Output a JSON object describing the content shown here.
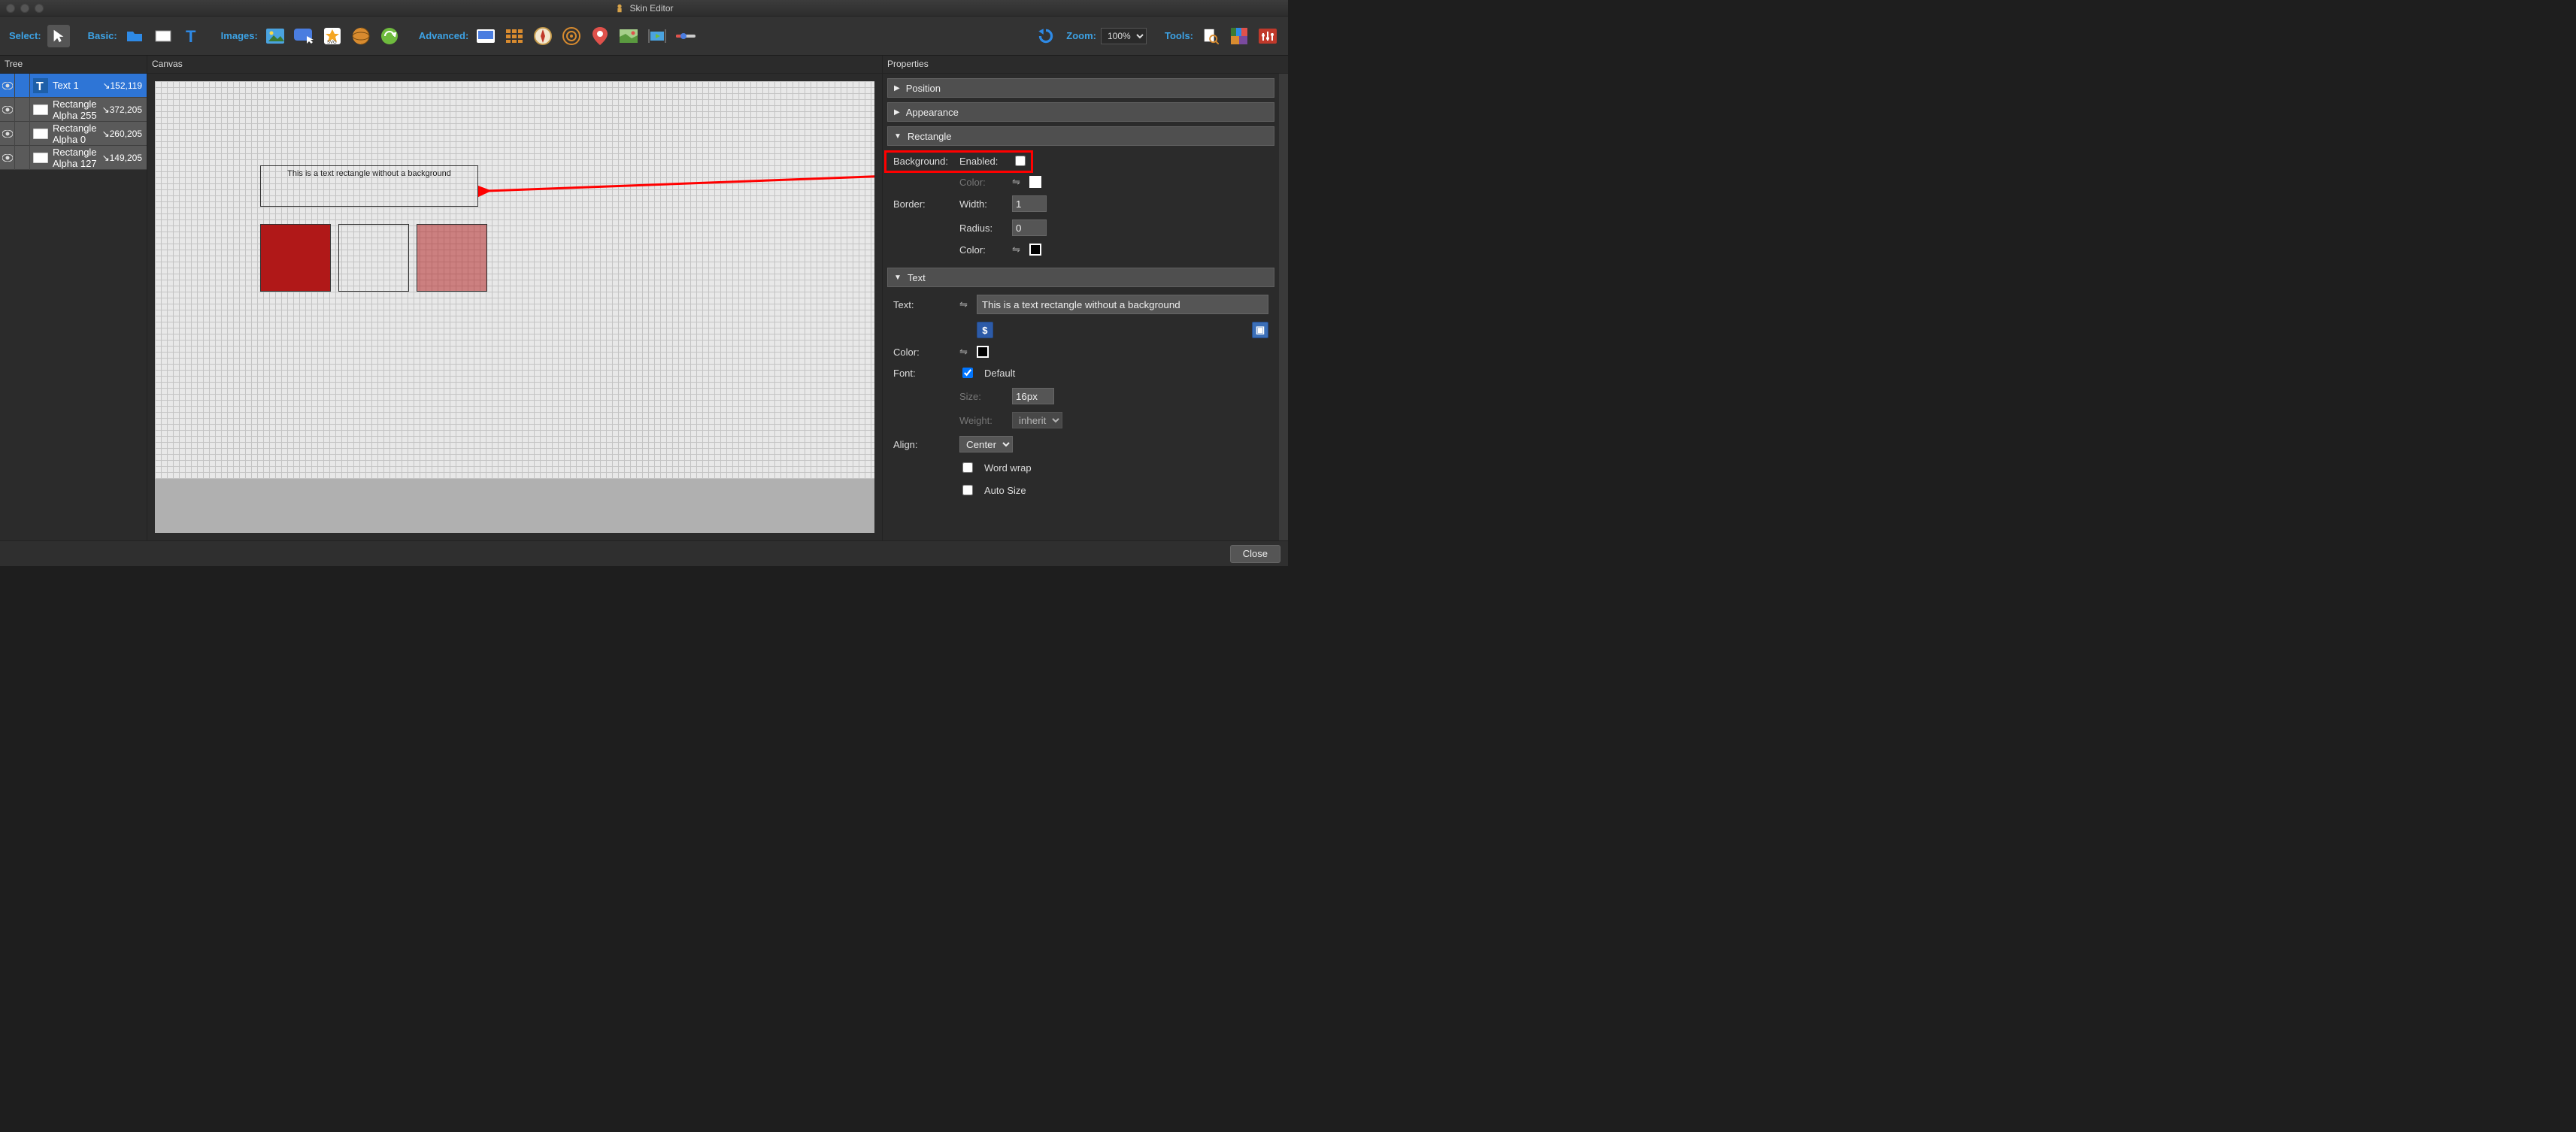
{
  "window": {
    "title": "Skin Editor"
  },
  "toolbar": {
    "select_label": "Select:",
    "basic_label": "Basic:",
    "images_label": "Images:",
    "advanced_label": "Advanced:",
    "zoom_label": "Zoom:",
    "zoom_value": "100%",
    "tools_label": "Tools:"
  },
  "panels": {
    "tree": "Tree",
    "canvas": "Canvas",
    "properties": "Properties"
  },
  "tree": {
    "items": [
      {
        "name": "Text 1",
        "coord": "↘152,119",
        "selected": true,
        "icon": "text"
      },
      {
        "name": "Rectangle Alpha 255",
        "coord": "↘372,205",
        "selected": false,
        "icon": "rect"
      },
      {
        "name": "Rectangle Alpha 0",
        "coord": "↘260,205",
        "selected": false,
        "icon": "rect"
      },
      {
        "name": "Rectangle Alpha 127",
        "coord": "↘149,205",
        "selected": false,
        "icon": "rect"
      }
    ]
  },
  "canvas": {
    "text_content": "This is a text rectangle without a background"
  },
  "props": {
    "sections": {
      "position": "Position",
      "appearance": "Appearance",
      "rectangle": "Rectangle",
      "text": "Text"
    },
    "rectangle": {
      "background_label": "Background:",
      "enabled_label": "Enabled:",
      "enabled_value": false,
      "bg_color_label": "Color:",
      "bg_color": "#ffffff",
      "border_label": "Border:",
      "width_label": "Width:",
      "width_value": "1",
      "radius_label": "Radius:",
      "radius_value": "0",
      "border_color_label": "Color:",
      "border_color": "#000000"
    },
    "text": {
      "text_label": "Text:",
      "text_value": "This is a text rectangle without a background",
      "dollar": "$",
      "color_label": "Color:",
      "color_value": "#000000",
      "font_label": "Font:",
      "default_label": "Default",
      "default_checked": true,
      "size_label": "Size:",
      "size_value": "16px",
      "weight_label": "Weight:",
      "weight_value": "inherit",
      "align_label": "Align:",
      "align_value": "Center",
      "wordwrap_label": "Word wrap",
      "wordwrap_checked": false,
      "autosize_label": "Auto Size",
      "autosize_checked": false
    }
  },
  "footer": {
    "close": "Close"
  }
}
